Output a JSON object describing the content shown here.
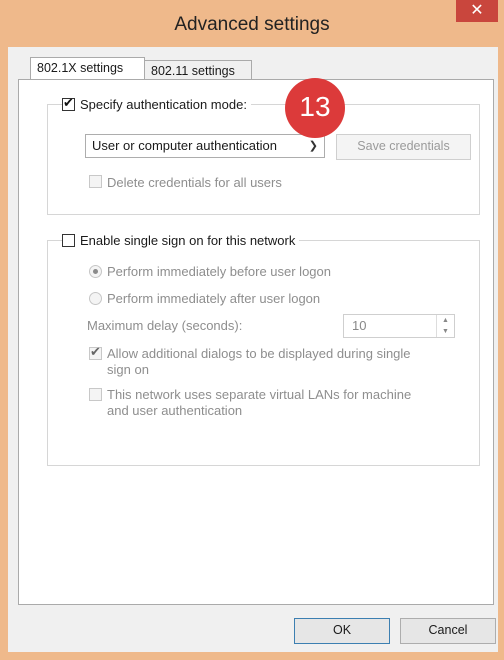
{
  "window": {
    "title": "Advanced settings",
    "close_glyph": "✕"
  },
  "tabs": [
    {
      "label": "802.1X settings",
      "active": true
    },
    {
      "label": "802.11 settings",
      "active": false
    }
  ],
  "auth_group": {
    "specify_label": "Specify authentication mode:",
    "specify_checked": true,
    "mode_selected": "User or computer authentication",
    "save_credentials_label": "Save credentials",
    "delete_credentials_label": "Delete credentials for all users"
  },
  "step_badge": "13",
  "sso_group": {
    "enable_label": "Enable single sign on for this network",
    "enable_checked": false,
    "radio_before_label": "Perform immediately before user logon",
    "radio_after_label": "Perform immediately after user logon",
    "max_delay_label": "Maximum delay (seconds):",
    "max_delay_value": "10",
    "allow_dialogs_label_1": "Allow additional dialogs to be displayed during single",
    "allow_dialogs_label_2": "sign on",
    "separate_vlan_label_1": "This network uses separate virtual LANs for machine",
    "separate_vlan_label_2": "and user authentication"
  },
  "footer": {
    "ok_label": "OK",
    "cancel_label": "Cancel"
  },
  "colors": {
    "frame": "#efb98b",
    "close": "#c9463d",
    "badge": "#dc3a3a"
  }
}
